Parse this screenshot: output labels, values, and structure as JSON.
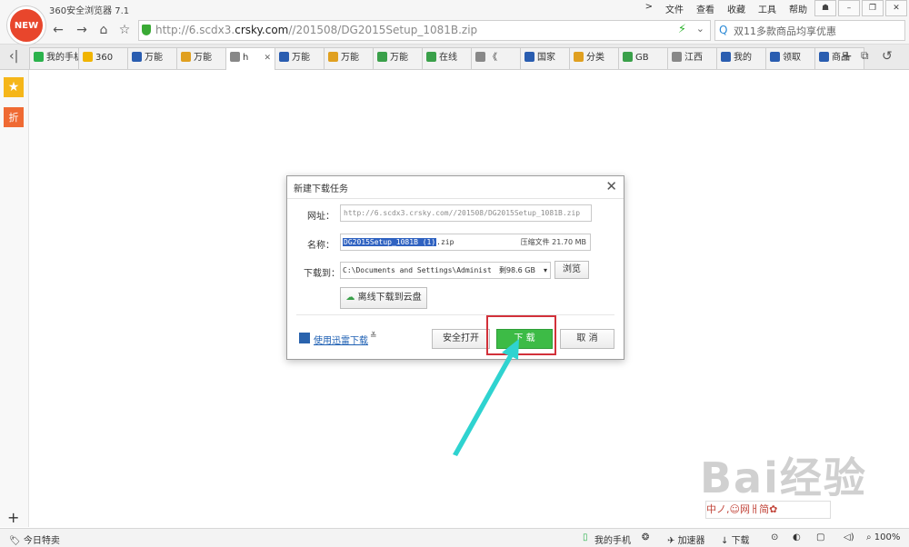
{
  "window": {
    "logo_text": "NEW",
    "app_title": "360安全浏览器 7.1",
    "menus": [
      ">",
      "文件",
      "查看",
      "收藏",
      "工具",
      "帮助"
    ]
  },
  "address_bar": {
    "url_prefix": "http://6.scdx3.",
    "url_domain": "crsky.com",
    "url_path": "//201508/DG2015Setup_1081B.zip",
    "search_placeholder": "双11多款商品均享优惠"
  },
  "tabs": [
    {
      "label": "我的手机",
      "color": "#2bb24c"
    },
    {
      "label": "360",
      "color": "#f0b400"
    },
    {
      "label": "万能",
      "color": "#2a5db0"
    },
    {
      "label": "万能",
      "color": "#e0a020"
    },
    {
      "label": "h",
      "color": "#888888",
      "active": true
    },
    {
      "label": "万能",
      "color": "#2a5db0"
    },
    {
      "label": "万能",
      "color": "#e0a020"
    },
    {
      "label": "万能",
      "color": "#3aa04a"
    },
    {
      "label": "在线",
      "color": "#3aa04a"
    },
    {
      "label": "《",
      "color": "#888888"
    },
    {
      "label": "国家",
      "color": "#2a5db0"
    },
    {
      "label": "分类",
      "color": "#e0a020"
    },
    {
      "label": "GB",
      "color": "#3aa04a"
    },
    {
      "label": "江西",
      "color": "#888888"
    },
    {
      "label": "我的",
      "color": "#2a5db0"
    },
    {
      "label": "领取",
      "color": "#2a5db0"
    },
    {
      "label": "商品",
      "color": "#2a5db0"
    }
  ],
  "dialog": {
    "title": "新建下载任务",
    "url_label": "网址：",
    "url_value": "http://6.scdx3.crsky.com//201508/DG2015Setup_1081B.zip",
    "name_label": "名称：",
    "name_selected": "DG2015Setup_1081B (1)",
    "name_ext": ".zip",
    "name_info": "压缩文件 21.70 MB",
    "path_label": "下载到：",
    "path_value": "C:\\Documents and Settings\\Administ",
    "path_free": "剩98.6 GB",
    "browse_label": "浏览",
    "cloud_label": "离线下载到云盘",
    "thunder_label": "使用迅雷下载",
    "safe_open_label": "安全打开",
    "download_label": "下 载",
    "cancel_label": "取 消"
  },
  "status_bar": {
    "left": "今日特卖",
    "mobile": "我的手机",
    "accelerator": "加速器",
    "downloads": "下载",
    "zoom": "100%"
  },
  "watermark": {
    "text": "Bai经验",
    "ime": "中ノ,☺网ㅐ简✿"
  },
  "colors": {
    "accent_green": "#3dbb46",
    "highlight_red": "#d2313a",
    "arrow_cyan": "#2fd3d0",
    "logo_red": "#e8462c"
  }
}
